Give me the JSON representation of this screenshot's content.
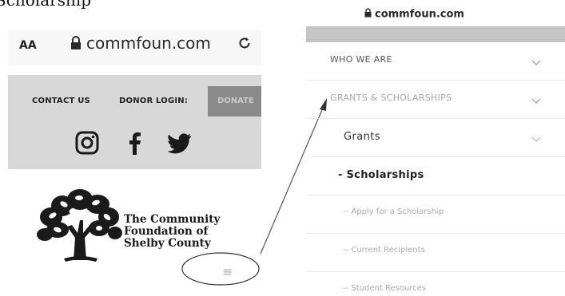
{
  "caption": "Scholarship",
  "left_phone": {
    "text_size": "AA",
    "url": "commfoun.com",
    "contact_us": "CONTACT US",
    "donor_login": "DONOR LOGIN:",
    "donate": "DONATE",
    "social": [
      "instagram-icon",
      "facebook-icon",
      "twitter-icon"
    ],
    "logo_lines": [
      "The Community",
      "Foundation of",
      "Shelby County"
    ],
    "menu_icon": "≡"
  },
  "right_phone": {
    "url": "commfoun.com",
    "menu": [
      {
        "label": "WHO WE ARE"
      },
      {
        "label": "GRANTS & SCHOLARSHIPS"
      },
      {
        "label": "Grants"
      },
      {
        "label": "- Scholarships"
      },
      {
        "label": "-- Apply for a Scholarship"
      },
      {
        "label": "-- Current Recipients"
      },
      {
        "label": "-- Student Resources"
      }
    ]
  },
  "colors": {
    "panel": "#d8d8d8",
    "donate_bg": "#8a8a8a",
    "menu_text": "#555555",
    "faded_text": "#a8a8a8"
  }
}
